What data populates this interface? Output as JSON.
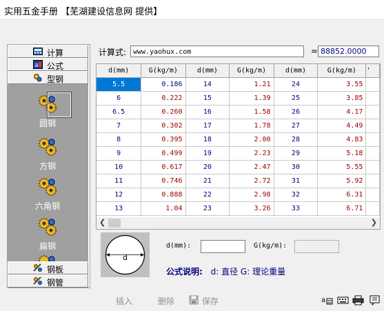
{
  "window": {
    "title": "实用五金手册 【芜湖建设信息网 提供】"
  },
  "sidebar": {
    "top_items": [
      {
        "label": "计算",
        "icon": "calculator-icon"
      },
      {
        "label": "公式",
        "icon": "formula-icon"
      },
      {
        "label": "型钢",
        "icon": "steel-section-icon"
      }
    ],
    "sub_items": [
      {
        "label": "圆钢",
        "icon": "gear-cluster-icon",
        "selected": true
      },
      {
        "label": "方钢",
        "icon": "gear-cluster-icon",
        "selected": false
      },
      {
        "label": "六角钢",
        "icon": "gear-cluster-icon",
        "selected": false
      },
      {
        "label": "扁钢",
        "icon": "gear-cluster-icon",
        "selected": false
      }
    ],
    "bottom_items": [
      {
        "label": "钢板",
        "icon": "steel-plate-icon"
      },
      {
        "label": "钢管",
        "icon": "steel-pipe-icon"
      }
    ]
  },
  "calculator": {
    "label": "计算式:",
    "expression": "www.yaohux.com",
    "equals": "=",
    "result": "88852.0000"
  },
  "table": {
    "headers": [
      "d(mm)",
      "G(kg/m)",
      "d(mm)",
      "G(kg/m)",
      "d(mm)",
      "G(kg/m)"
    ],
    "rows": [
      [
        "5.5",
        "0.186",
        "14",
        "1.21",
        "24",
        "3.55"
      ],
      [
        "6",
        "0.222",
        "15",
        "1.39",
        "25",
        "3.85"
      ],
      [
        "6.5",
        "0.260",
        "16",
        "1.58",
        "26",
        "4.17"
      ],
      [
        "7",
        "0.302",
        "17",
        "1.78",
        "27",
        "4.49"
      ],
      [
        "8",
        "0.395",
        "18",
        "2.00",
        "28",
        "4.83"
      ],
      [
        "9",
        "0.499",
        "19",
        "2.23",
        "29",
        "5.18"
      ],
      [
        "10",
        "0.617",
        "20",
        "2.47",
        "30",
        "5.55"
      ],
      [
        "11",
        "0.746",
        "21",
        "2.72",
        "31",
        "5.92"
      ],
      [
        "12",
        "0.888",
        "22",
        "2.98",
        "32",
        "6.31"
      ],
      [
        "13",
        "1.04",
        "23",
        "3.26",
        "33",
        "6.71"
      ]
    ],
    "selected_cell": "5.5"
  },
  "cross_section": {
    "diagram_label": "d"
  },
  "inputs": {
    "d_label": "d(mm):",
    "d_value": "",
    "g_label": "G(kg/m):",
    "g_value": ""
  },
  "formula": {
    "title": "公式说明:",
    "text": "d: 直径 G: 理论重量"
  },
  "toolbar": {
    "insert_label": "插入",
    "delete_label": "删除",
    "save_label": "保存"
  },
  "colors": {
    "accent": "#0078d7",
    "data_blue": "#00007f",
    "data_red": "#a00000",
    "panel_gray": "#a0a0a0"
  }
}
